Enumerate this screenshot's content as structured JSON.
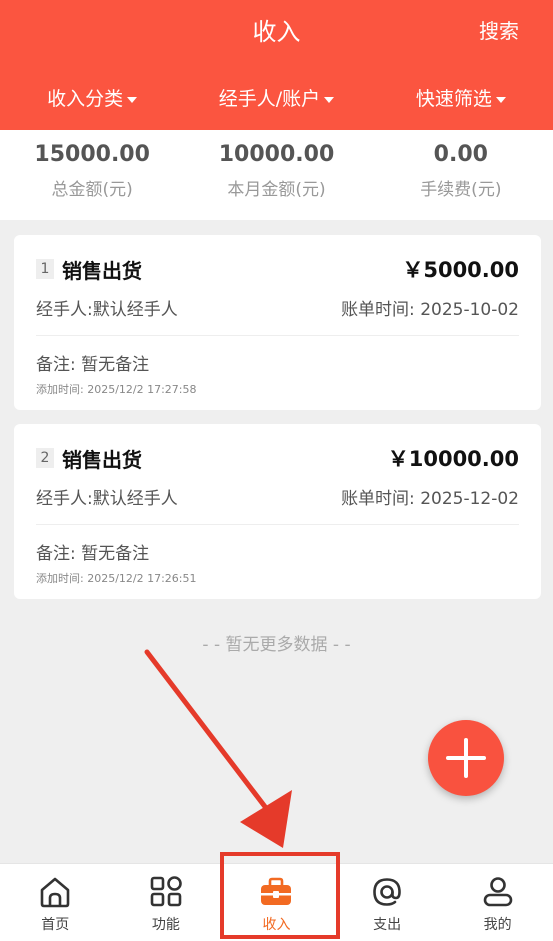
{
  "header": {
    "title": "收入",
    "search_label": "搜索",
    "bg_color": "#fb5540"
  },
  "filters": [
    "收入分类",
    "经手人/账户",
    "快速筛选"
  ],
  "summary": [
    {
      "value": "15000.00",
      "label": "总金额(元)"
    },
    {
      "value": "10000.00",
      "label": "本月金额(元)"
    },
    {
      "value": "0.00",
      "label": "手续费(元)"
    }
  ],
  "records": [
    {
      "index": "1",
      "name": "销售出货",
      "amount": "￥5000.00",
      "handler": "经手人:默认经手人",
      "bill_time": "账单时间: 2025-10-02",
      "remark": "备注: 暂无备注",
      "added_time": "添加时间: 2025/12/2 17:27:58"
    },
    {
      "index": "2",
      "name": "销售出货",
      "amount": "￥10000.00",
      "handler": "经手人:默认经手人",
      "bill_time": "账单时间: 2025-12-02",
      "remark": "备注: 暂无备注",
      "added_time": "添加时间: 2025/12/2 17:26:51"
    }
  ],
  "no_more": "- - 暂无更多数据 - -",
  "fab_icon": "plus-icon",
  "tabs": [
    {
      "label": "首页",
      "icon": "home-icon"
    },
    {
      "label": "功能",
      "icon": "apps-icon"
    },
    {
      "label": "收入",
      "icon": "toolbox-icon",
      "active": true
    },
    {
      "label": "支出",
      "icon": "at-icon"
    },
    {
      "label": "我的",
      "icon": "user-icon"
    }
  ],
  "colors": {
    "accent": "#f26a22",
    "annotation": "#e53a2a"
  }
}
